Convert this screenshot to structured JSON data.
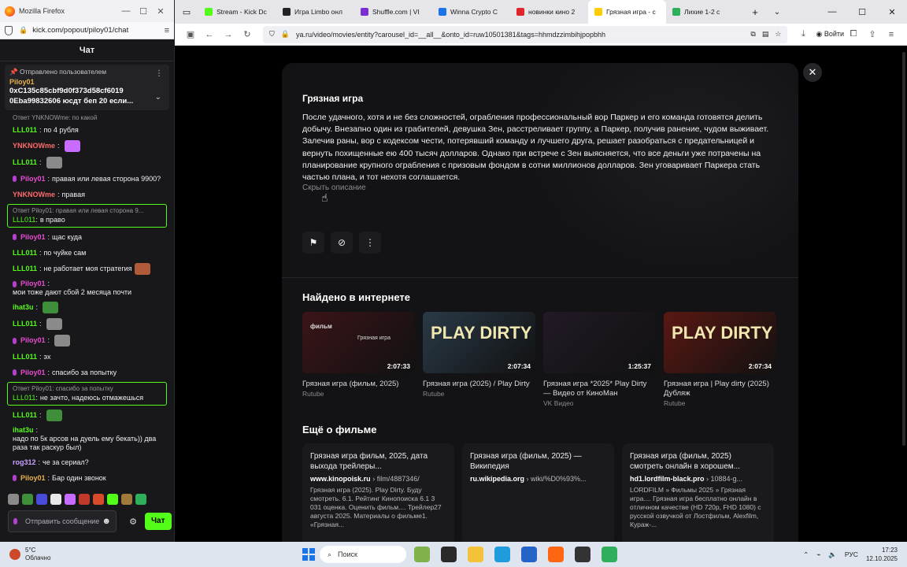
{
  "chat_window": {
    "title": "Mozilla Firefox",
    "url": "kick.com/popout/piloy01/chat",
    "header": "Чат",
    "pinned": {
      "pinned_by": "Отправлено пользователем",
      "user": "Piloy01",
      "text": "0xC135c85cbf9d0f373d58cf6019 0Eba99832606 юсдт беп 20 если..."
    },
    "messages": [
      {
        "reply_ref": "Ответ YNKNOWme: по какой",
        "user": "LLL011",
        "text": "по 4 рубля",
        "color": "#53fc18"
      },
      {
        "user": "YNKNOWme",
        "text": "",
        "color": "#ff6b6b",
        "emote": "#c86bff"
      },
      {
        "user": "LLL011",
        "text": "",
        "color": "#53fc18",
        "emote": "#8a8a8a"
      },
      {
        "user": "Piloy01",
        "text": "правая или левая сторона 9900?",
        "color": "#e84bd1",
        "mic": true
      },
      {
        "user": "YNKNOWme",
        "text": "правая",
        "color": "#ff6b6b"
      },
      {
        "reply_ref": "Ответ Piloy01: правая или левая сторона 9...",
        "user": "LLL011",
        "text": "в право",
        "color": "#53fc18",
        "boxed": true
      },
      {
        "user": "Piloy01",
        "text": "щас куда",
        "color": "#e84bd1",
        "mic": true
      },
      {
        "user": "LLL011",
        "text": "по чуйке сам",
        "color": "#53fc18"
      },
      {
        "user": "LLL011",
        "text": "не работает моя стратегия",
        "color": "#53fc18",
        "emote": "#b05a3a"
      },
      {
        "user": "Piloy01",
        "text": "мои тоже дают сбой 2 месяца почти",
        "color": "#e84bd1",
        "mic": true
      },
      {
        "user": "ihat3u",
        "text": "",
        "color": "#53fc18",
        "emote": "#3f8f3a"
      },
      {
        "user": "LLL011",
        "text": "",
        "color": "#53fc18",
        "emote": "#8a8a8a"
      },
      {
        "user": "Piloy01",
        "text": "",
        "color": "#e84bd1",
        "mic": true,
        "emote": "#8a8a8a"
      },
      {
        "user": "LLL011",
        "text": "эх",
        "color": "#53fc18"
      },
      {
        "user": "Piloy01",
        "text": "спасибо за попытку",
        "color": "#e84bd1",
        "mic": true
      },
      {
        "reply_ref": "Ответ Piloy01: спасибо за попытку",
        "user": "LLL011",
        "text": "не зачто, надеюсь отмажешься",
        "color": "#53fc18",
        "boxed": true
      },
      {
        "user": "LLL011",
        "text": "",
        "color": "#53fc18",
        "emote": "#3f8f3a"
      },
      {
        "user": "ihat3u",
        "text": "надо по 5к арсов на дуель ему бекать)) два раза так раскур был)",
        "color": "#53fc18"
      },
      {
        "user": "rog312",
        "text": "че за сериал?",
        "color": "#c9a0ff"
      },
      {
        "user": "Piloy01",
        "text": "Бар один звонок",
        "color": "#e8b14b",
        "mic": true
      }
    ],
    "input_placeholder": "Отправить сообщение",
    "send_label": "Чат"
  },
  "browser": {
    "tabs": [
      {
        "label": "Stream - Kick Dc",
        "color": "#53fc18"
      },
      {
        "label": "Игра Limbo онл",
        "color": "#222222"
      },
      {
        "label": "Shuffle.com | VI",
        "color": "#7b2fd1"
      },
      {
        "label": "Winna Crypto C",
        "color": "#1a73e8"
      },
      {
        "label": "новинки кино 2",
        "color": "#e0242b"
      },
      {
        "label": "Грязная игра - с",
        "color": "#ffcc00",
        "active": true
      },
      {
        "label": "Лихие 1-2 с",
        "color": "#2fae5b"
      }
    ],
    "url": "ya.ru/video/movies/entity?carousel_id=__all__&onto_id=ruw10501381&tags=hhmdzzimbihjpopbhh",
    "login": "Войти"
  },
  "movie": {
    "title": "Грязная игра",
    "description": "После удачного, хотя и не без сложностей, ограбления профессиональный вор Паркер и его команда готовятся делить добычу. Внезапно один из грабителей, девушка Зен, расстреливает группу, а Паркер, получив ранение, чудом выживает. Залечив раны, вор с кодексом чести, потерявший команду и лучшего друга, решает разобраться с предательницей и вернуть похищенные ею 400 тысяч долларов. Однако при встрече с Зен выясняется, что все деньги уже потрачены на планирование крупного ограбления с призовым фондом в сотни миллионов долларов. Зен уговаривает Паркера стать частью плана, и тот нехотя соглашается.",
    "hide_label": "Скрыть описание"
  },
  "found_section": {
    "title": "Найдено в интернете",
    "videos": [
      {
        "title": "Грязная игра (фильм, 2025)",
        "source": "Rutube",
        "duration": "2:07:33",
        "thumb": "#3a1418",
        "thumb_title": "фильм",
        "thumb_sub": "Грязная игра"
      },
      {
        "title": "Грязная игра (2025) / Play Dirty",
        "source": "Rutube",
        "duration": "2:07:34",
        "thumb": "#2a3a48",
        "thumb_title": "PLAY DIRTY",
        "thumb_sub": ""
      },
      {
        "title": "Грязная игра *2025* Play Dirty — Видео от КиноМан",
        "source": "VK Видео",
        "duration": "1:25:37",
        "thumb": "#221a26",
        "thumb_title": "",
        "thumb_sub": ""
      },
      {
        "title": "Грязная игра | Play dirty (2025) Дубляж",
        "source": "Rutube",
        "duration": "2:07:34",
        "thumb": "#5a1812",
        "thumb_title": "PLAY DIRTY",
        "thumb_sub": ""
      }
    ]
  },
  "more_section": {
    "title": "Ещё о фильме",
    "cards": [
      {
        "title": "Грязная игра фильм, 2025, дата выхода трейлеры...",
        "site": "www.kinopoisk.ru",
        "path": "› film/4887346/",
        "text": "Грязная игра (2025). Play Dirty. Буду смотреть. 6.1. Рейтинг Кинопоиска 6.1 3 031 оценка. Оценить фильм.... Трейлер27 августа 2025. Материалы о фильме1. «Грязная..."
      },
      {
        "title": "Грязная игра (фильм, 2025) — Википедия",
        "site": "ru.wikipedia.org",
        "path": "› wiki/%D0%93%...",
        "text": ""
      },
      {
        "title": "Грязная игра (фильм, 2025) смотреть онлайн в хорошем...",
        "site": "hd1.lordfilm-black.pro",
        "path": "› 10884-g...",
        "text": "LORDFILM » Фильмы 2025 » Грязная игра.... Грязная игра бесплатно онлайн в отличном качестве (HD 720p, FHD 1080) с русской озвучкой от Лостфильм, Alexfilm, Кураж-..."
      }
    ]
  },
  "taskbar": {
    "temp": "5°C",
    "weather": "Облачно",
    "search": "Поиск",
    "lang": "РУС",
    "time": "17:23",
    "date": "12.10.2025"
  }
}
